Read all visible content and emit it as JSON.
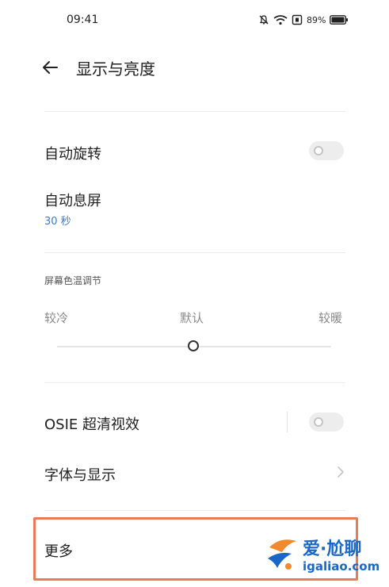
{
  "status_bar": {
    "time": "09:41",
    "battery_percent": "89%",
    "icons": [
      "bell-off-icon",
      "wifi-icon",
      "nfc-icon",
      "battery-icon"
    ]
  },
  "header": {
    "back_icon": "arrow-left-icon",
    "title": "显示与亮度"
  },
  "auto_rotate": {
    "label": "自动旋转",
    "enabled": false
  },
  "auto_screen_off": {
    "label": "自动息屏",
    "value": "30 秒"
  },
  "color_temperature": {
    "section_label": "屏幕色温调节",
    "cool_label": "较冷",
    "default_label": "默认",
    "warm_label": "较暖",
    "level": 0.5
  },
  "osie": {
    "label": "OSIE 超清视效",
    "enabled": false
  },
  "font_display": {
    "label": "字体与显示"
  },
  "more": {
    "label": "更多"
  },
  "watermark": {
    "brand": "爱·尬聊",
    "domain": "igaliao.com"
  },
  "colors": {
    "accent_blue": "#3b7cc4",
    "highlight_border": "#e87c57",
    "toggle_off": "#ededed",
    "watermark_blue": "#1a67c8",
    "watermark_orange": "#f08a2c"
  }
}
